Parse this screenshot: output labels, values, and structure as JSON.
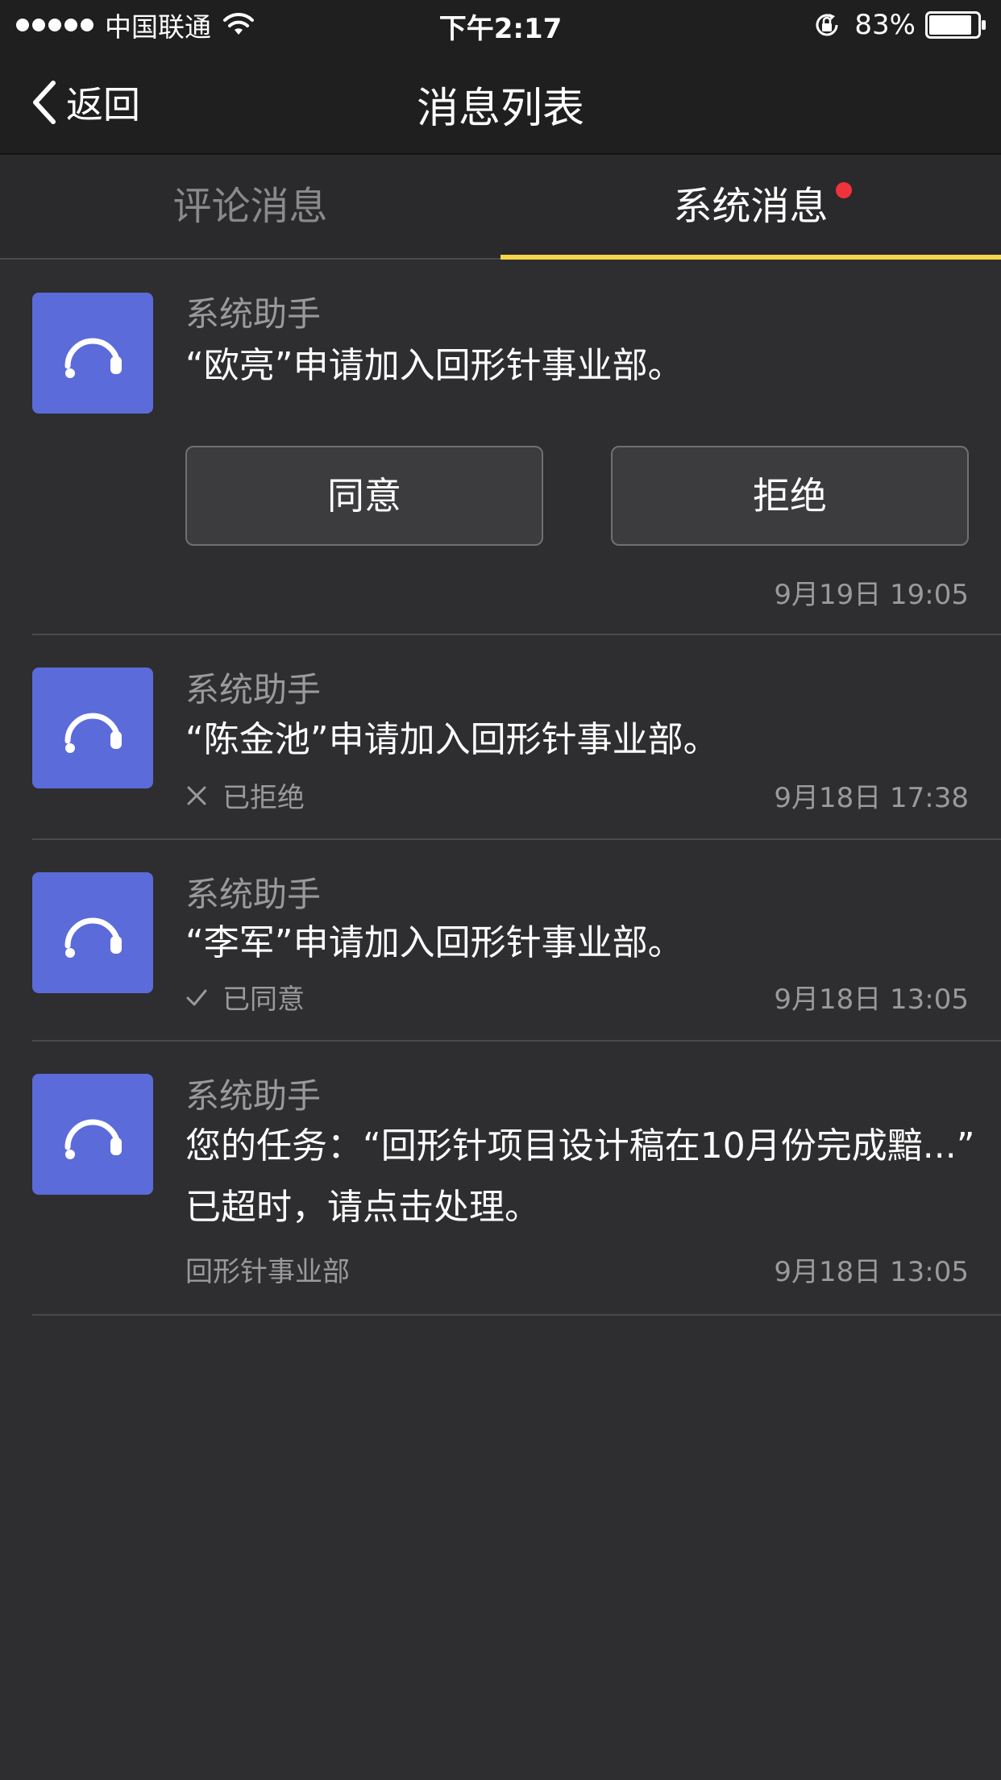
{
  "status_bar": {
    "carrier": "中国联通",
    "time": "下午2:17",
    "battery": "83%"
  },
  "nav": {
    "back_label": "返回",
    "title": "消息列表"
  },
  "tabs": [
    {
      "label": "评论消息",
      "active": false
    },
    {
      "label": "系统消息",
      "active": true,
      "unread": true
    }
  ],
  "colors": {
    "accent": "#f7d44a",
    "avatar": "#5b6bd9",
    "unread_dot": "#f0333a"
  },
  "messages": [
    {
      "sender": "系统助手",
      "text": "“欧亮”申请加入回形针事业部。",
      "actions": [
        "同意",
        "拒绝"
      ],
      "time": "9月19日  19:05"
    },
    {
      "sender": "系统助手",
      "text": "“陈金池”申请加入回形针事业部。",
      "status": "已拒绝",
      "status_icon": "close-icon",
      "time": "9月18日  17:38"
    },
    {
      "sender": "系统助手",
      "text": "“李军”申请加入回形针事业部。",
      "status": "已同意",
      "status_icon": "check-icon",
      "time": "9月18日  13:05"
    },
    {
      "sender": "系统助手",
      "text_line1": "您的任务：“回形针项目设计稿在10月份完成黯...”",
      "text_line2": "已超时，请点击处理。",
      "dept": "回形针事业部",
      "time": "9月18日  13:05"
    }
  ]
}
